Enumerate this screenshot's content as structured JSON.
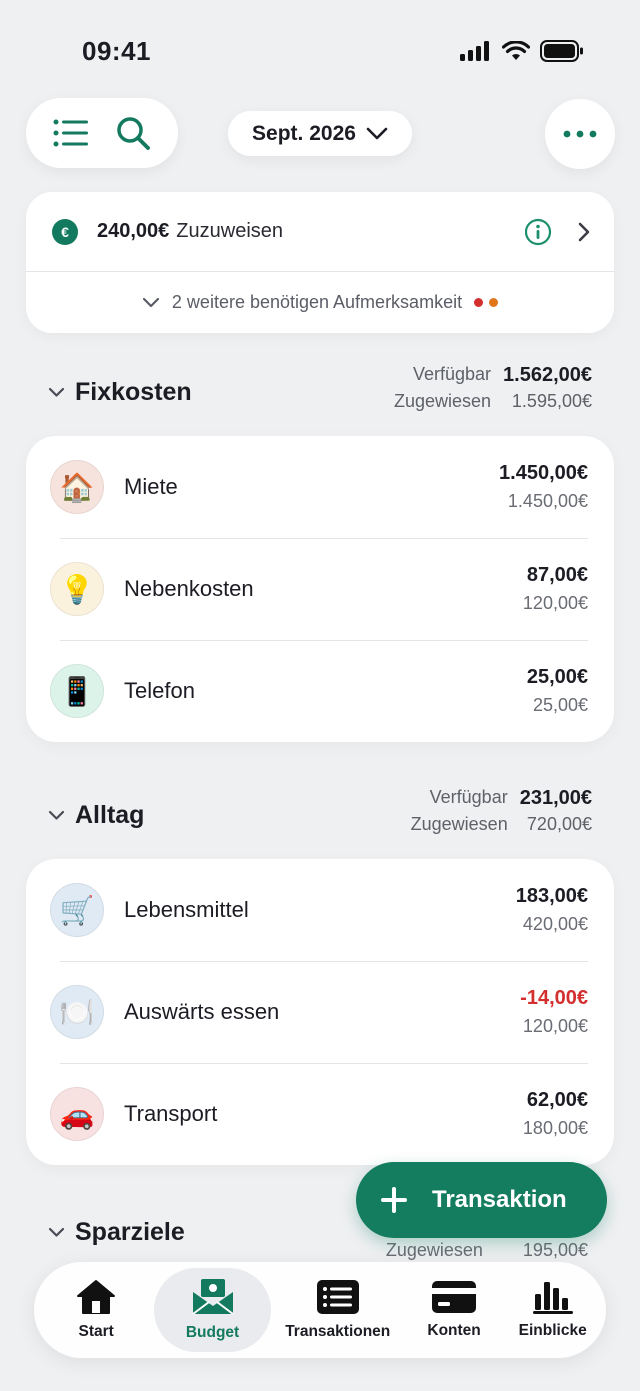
{
  "status_bar": {
    "time": "09:41"
  },
  "header": {
    "month": "Sept. 2026",
    "icons": {
      "menu": "list-icon",
      "search": "search-icon",
      "more": "more-icon"
    }
  },
  "assign": {
    "currency_symbol": "€",
    "amount": "240,00€",
    "label": "Zuzuweisen",
    "attention": "2 weitere benötigen Aufmerksamkeit",
    "dot_colors": [
      "#d32f2f",
      "#e0761a"
    ]
  },
  "groups": [
    {
      "title": "Fixkosten",
      "available_label": "Verfügbar",
      "available": "1.562,00€",
      "assigned_label": "Zugewiesen",
      "assigned": "1.595,00€",
      "items": [
        {
          "name": "Miete",
          "emoji": "🏠",
          "main": "1.450,00€",
          "sub": "1.450,00€",
          "bg": "#f7e3dd"
        },
        {
          "name": "Nebenkosten",
          "emoji": "💡",
          "main": "87,00€",
          "sub": "120,00€",
          "bg": "#faf2dd"
        },
        {
          "name": "Telefon",
          "emoji": "📱",
          "main": "25,00€",
          "sub": "25,00€",
          "bg": "#dcf3ea"
        }
      ]
    },
    {
      "title": "Alltag",
      "available_label": "Verfügbar",
      "available": "231,00€",
      "assigned_label": "Zugewiesen",
      "assigned": "720,00€",
      "items": [
        {
          "name": "Lebensmittel",
          "emoji": "🛒",
          "main": "183,00€",
          "sub": "420,00€",
          "bg": "#e0eaf4"
        },
        {
          "name": "Auswärts essen",
          "emoji": "🍽️",
          "main": "-14,00€",
          "sub": "120,00€",
          "bg": "#e0eaf4",
          "negative": true
        },
        {
          "name": "Transport",
          "emoji": "🚗",
          "main": "62,00€",
          "sub": "180,00€",
          "bg": "#f8e1e1"
        }
      ]
    },
    {
      "title": "Sparziele",
      "assigned_label": "Zugewiesen",
      "assigned": "195,00€"
    }
  ],
  "fab": {
    "label": "Transaktion"
  },
  "tabbar": {
    "tabs": [
      {
        "label": "Start",
        "icon": "home-icon"
      },
      {
        "label": "Budget",
        "icon": "budget-envelope-icon",
        "active": true
      },
      {
        "label": "Transaktionen",
        "icon": "list-icon"
      },
      {
        "label": "Konten",
        "icon": "card-icon"
      },
      {
        "label": "Einblicke",
        "icon": "bar-chart-icon"
      }
    ]
  },
  "colors": {
    "accent": "#137a5f",
    "negative": "#d32f2f",
    "background": "#eff0f2"
  }
}
